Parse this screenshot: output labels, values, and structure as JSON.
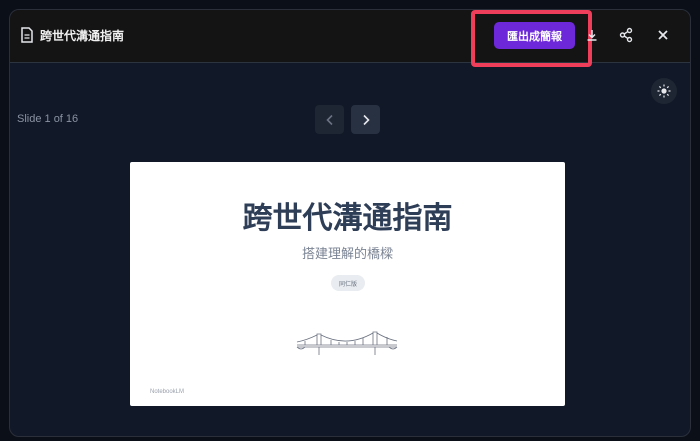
{
  "header": {
    "title": "跨世代溝通指南",
    "export_label": "匯出成簡報"
  },
  "viewer": {
    "slide_counter": "Slide 1 of 16"
  },
  "slide": {
    "title": "跨世代溝通指南",
    "subtitle": "搭建理解的橋樑",
    "tag": "同仁版",
    "footer": "NotebookLM"
  },
  "colors": {
    "accent": "#6d28d9",
    "highlight": "#ef3e5a",
    "background": "#111827"
  },
  "icons": [
    "document-icon",
    "download-icon",
    "share-icon",
    "close-icon",
    "sun-icon",
    "chevron-left-icon",
    "chevron-right-icon"
  ]
}
